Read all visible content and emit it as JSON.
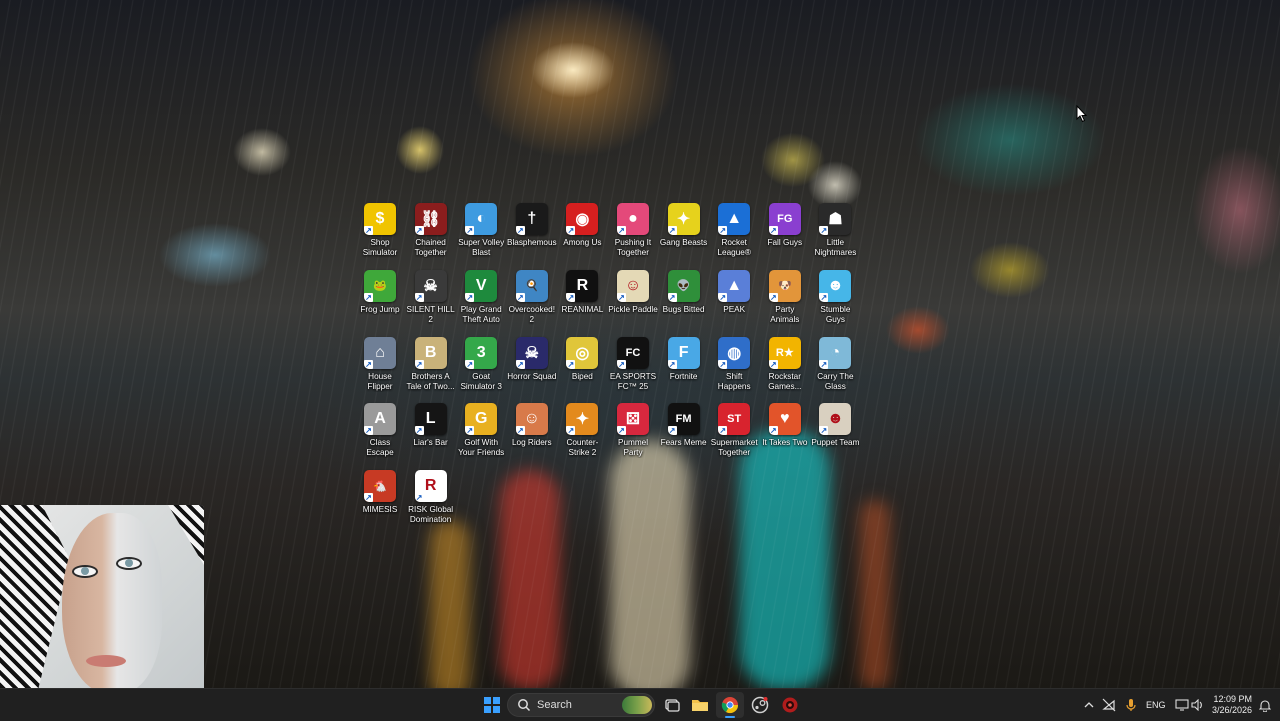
{
  "desktop": {
    "icons": [
      {
        "label": "Shop Simulator",
        "icon": "dollar-coin-icon",
        "color": "#f0c400",
        "glyph": "$"
      },
      {
        "label": "Chained Together",
        "icon": "chained-together-icon",
        "color": "#8b1d1d",
        "glyph": "⛓"
      },
      {
        "label": "Super Volley Blast",
        "icon": "volleyball-icon",
        "color": "#3e9be0",
        "glyph": "◐"
      },
      {
        "label": "Blasphemous",
        "icon": "blasphemous-icon",
        "color": "#1a1a1a",
        "glyph": "†"
      },
      {
        "label": "Among Us",
        "icon": "among-us-icon",
        "color": "#d61f1f",
        "glyph": "◉"
      },
      {
        "label": "Pushing It Together",
        "icon": "pushing-it-together-icon",
        "color": "#e4497a",
        "glyph": "●"
      },
      {
        "label": "Gang Beasts",
        "icon": "gang-beasts-icon",
        "color": "#e6d21c",
        "glyph": "✦"
      },
      {
        "label": "Rocket League®",
        "icon": "rocket-league-icon",
        "color": "#1b6fd6",
        "glyph": "▲"
      },
      {
        "label": "Fall Guys",
        "icon": "fall-guys-icon",
        "color": "#8a3fd0",
        "glyph": "FG"
      },
      {
        "label": "Little Nightmares",
        "icon": "little-nightmares-icon",
        "color": "#2a2a2a",
        "glyph": "☗"
      },
      {
        "label": "Frog Jump",
        "icon": "frog-icon",
        "color": "#3fa83a",
        "glyph": "🐸"
      },
      {
        "label": "SILENT HILL 2",
        "icon": "silent-hill-icon",
        "color": "#3a3a3a",
        "glyph": "☠"
      },
      {
        "label": "Play Grand Theft Auto",
        "icon": "gta-icon",
        "color": "#1e8a3d",
        "glyph": "V"
      },
      {
        "label": "Overcooked! 2",
        "icon": "overcooked-icon",
        "color": "#3f86c4",
        "glyph": "🍳"
      },
      {
        "label": "REANIMAL",
        "icon": "reanimal-icon",
        "color": "#101010",
        "glyph": "R"
      },
      {
        "label": "Pickle Paddle",
        "icon": "pickle-paddle-icon",
        "color": "#e4d9b6",
        "glyph": "☺"
      },
      {
        "label": "Bugs Bitted",
        "icon": "alien-icon",
        "color": "#2f8f3a",
        "glyph": "👽"
      },
      {
        "label": "PEAK",
        "icon": "peak-icon",
        "color": "#5a7fd8",
        "glyph": "▲"
      },
      {
        "label": "Party Animals",
        "icon": "party-animals-icon",
        "color": "#e2953a",
        "glyph": "🐶"
      },
      {
        "label": "Stumble Guys",
        "icon": "stumble-guys-icon",
        "color": "#46b6e8",
        "glyph": "☻"
      },
      {
        "label": "House Flipper",
        "icon": "house-flipper-icon",
        "color": "#6f7f96",
        "glyph": "⌂"
      },
      {
        "label": "Brothers A Tale of Two...",
        "icon": "brothers-icon",
        "color": "#c9b27a",
        "glyph": "B"
      },
      {
        "label": "Goat Simulator 3",
        "icon": "goat-simulator-icon",
        "color": "#34a84a",
        "glyph": "3"
      },
      {
        "label": "Horror Squad",
        "icon": "horror-squad-icon",
        "color": "#2a2a6a",
        "glyph": "☠"
      },
      {
        "label": "Biped",
        "icon": "biped-icon",
        "color": "#e0c63a",
        "glyph": "◎"
      },
      {
        "label": "EA SPORTS FC™ 25",
        "icon": "ea-fc-icon",
        "color": "#111111",
        "glyph": "FC"
      },
      {
        "label": "Fortnite",
        "icon": "fortnite-icon",
        "color": "#49a8e6",
        "glyph": "F"
      },
      {
        "label": "Shift Happens",
        "icon": "shift-happens-icon",
        "color": "#2f6ec9",
        "glyph": "◍"
      },
      {
        "label": "Rockstar Games...",
        "icon": "rockstar-icon",
        "color": "#f2b400",
        "glyph": "R★"
      },
      {
        "label": "Carry The Glass",
        "icon": "carry-the-glass-icon",
        "color": "#7fb9d8",
        "glyph": "◔"
      },
      {
        "label": "Class Escape",
        "icon": "class-escape-icon",
        "color": "#9a9a9a",
        "glyph": "A"
      },
      {
        "label": "Liar's Bar",
        "icon": "liars-bar-icon",
        "color": "#151515",
        "glyph": "L"
      },
      {
        "label": "Golf With Your Friends",
        "icon": "golf-icon",
        "color": "#e8b020",
        "glyph": "G"
      },
      {
        "label": "Log Riders",
        "icon": "log-riders-icon",
        "color": "#d87a4a",
        "glyph": "☺"
      },
      {
        "label": "Counter-Strike 2",
        "icon": "counter-strike-icon",
        "color": "#e38a1d",
        "glyph": "✦"
      },
      {
        "label": "Pummel Party",
        "icon": "pummel-party-icon",
        "color": "#d7283e",
        "glyph": "⚄"
      },
      {
        "label": "Fears Meme",
        "icon": "fears-meme-icon",
        "color": "#111111",
        "glyph": "FM"
      },
      {
        "label": "Supermarket Together",
        "icon": "supermarket-together-icon",
        "color": "#d8232e",
        "glyph": "ST"
      },
      {
        "label": "It Takes Two",
        "icon": "it-takes-two-icon",
        "color": "#e2542a",
        "glyph": "♥"
      },
      {
        "label": "Puppet Team",
        "icon": "puppet-team-icon",
        "color": "#d9d0c0",
        "glyph": "☻"
      },
      {
        "label": "MIMESIS",
        "icon": "mimesis-icon",
        "color": "#c73a24",
        "glyph": "🐔"
      },
      {
        "label": "RISK Global Domination",
        "icon": "risk-icon",
        "color": "#ffffff",
        "glyph": "R"
      }
    ]
  },
  "taskbar": {
    "search_label": "Search",
    "apps": [
      "windows-start-icon",
      "task-view-icon",
      "file-explorer-icon",
      "chrome-icon",
      "steam-icon",
      "game-app-icon"
    ],
    "language": "ENG",
    "time": "12:09 PM",
    "date": "3/26/2026",
    "accent": "#3aa0ff"
  }
}
